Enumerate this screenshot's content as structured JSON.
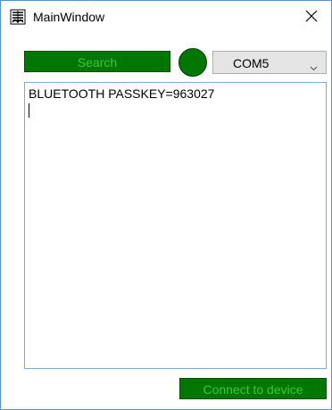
{
  "window": {
    "title": "MainWindow"
  },
  "toolbar": {
    "search_label": "Search",
    "status_color": "#007700",
    "port_selected": "COM5"
  },
  "console": {
    "lines": [
      "BLUETOOTH PASSKEY=963027"
    ]
  },
  "footer": {
    "connect_label": "Connect to device"
  },
  "icons": {
    "app": "app-window-icon",
    "close": "close-icon",
    "dropdown": "chevron-down-icon"
  },
  "colors": {
    "accent_green": "#007700",
    "button_text": "#3cc63c",
    "window_border": "#5b8fd4"
  }
}
